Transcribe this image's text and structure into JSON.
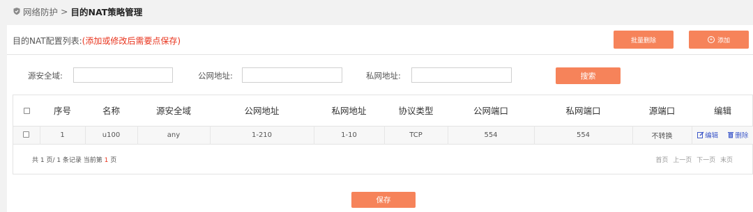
{
  "breadcrumb": {
    "parent": "网络防护",
    "separator": ">",
    "current": "目的NAT策略管理"
  },
  "list": {
    "title": "目的NAT配置列表:",
    "hint": "(添加或修改后需要点保存)"
  },
  "toolbar": {
    "batch_delete": "批量删除",
    "add": "添加"
  },
  "search": {
    "src_zone_label": "源安全域:",
    "public_addr_label": "公网地址:",
    "private_addr_label": "私网地址:",
    "button": "搜索"
  },
  "table": {
    "columns": [
      "序号",
      "名称",
      "源安全域",
      "公网地址",
      "私网地址",
      "协议类型",
      "公网端口",
      "私网端口",
      "源端口",
      "编辑"
    ],
    "rows": [
      {
        "index": "1",
        "name": "u100",
        "src_zone": "any",
        "public_addr": "1-210",
        "private_addr": "1-10",
        "protocol": "TCP",
        "public_port": "554",
        "private_port": "554",
        "src_port": "不转换"
      }
    ],
    "actions": {
      "edit": "编辑",
      "delete": "删除"
    }
  },
  "pager": {
    "summary_prefix": "共 1 页/ 1 条记录 当前第",
    "current_page": "1",
    "summary_suffix": "页",
    "first": "首页",
    "prev": "上一页",
    "next": "下一页",
    "last": "末页"
  },
  "footer": {
    "save": "保存"
  },
  "colors": {
    "accent": "#f6835a",
    "hint": "#e8331c",
    "link": "#3d58c9"
  }
}
